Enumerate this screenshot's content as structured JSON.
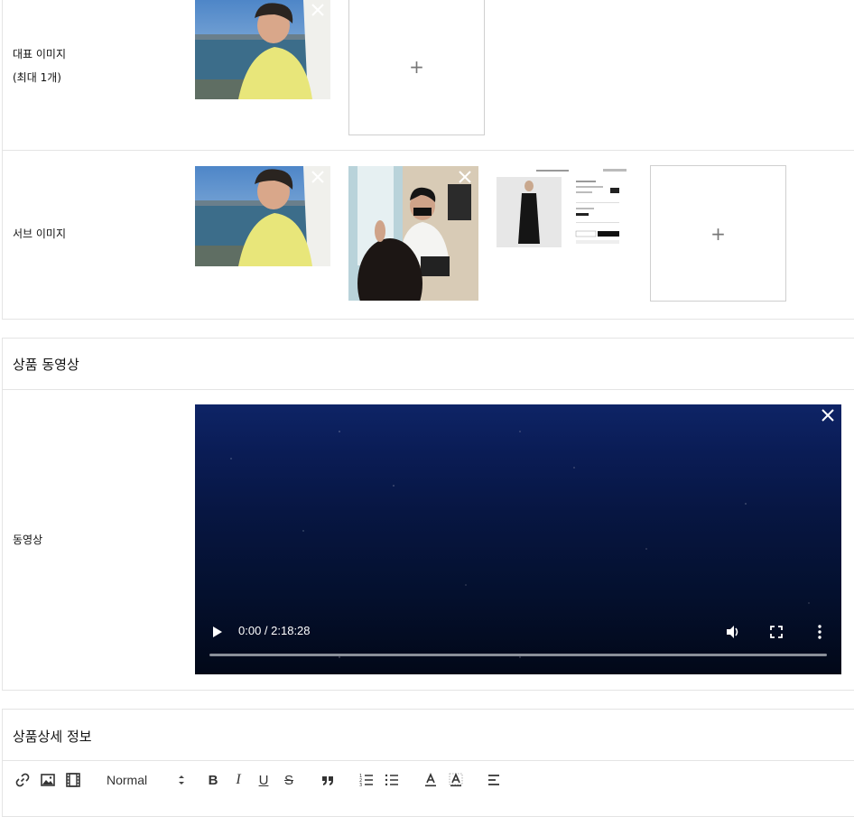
{
  "main_image": {
    "label_line1": "대표 이미지",
    "label_line2": "(최대 1개)",
    "add_symbol": "+"
  },
  "sub_image": {
    "label": "서브 이미지",
    "add_symbol": "+"
  },
  "video_section": {
    "title": "상품 동영상",
    "row_label": "동영상",
    "time_display": "0:00 / 2:18:28",
    "progress_fraction": 0
  },
  "detail_section": {
    "title": "상품상세 정보",
    "toolbar": {
      "format_select_value": "Normal",
      "icons": [
        "link-icon",
        "image-icon",
        "video-icon",
        "bold-icon",
        "italic-icon",
        "underline-icon",
        "strike-icon",
        "blockquote-icon",
        "ordered-list-icon",
        "bullet-list-icon",
        "font-color-icon",
        "background-color-icon",
        "align-icon"
      ]
    }
  },
  "colors": {
    "border": "#e4e4e4",
    "shirt_yellow": "#e8e67a",
    "video_bg": "#071642"
  }
}
